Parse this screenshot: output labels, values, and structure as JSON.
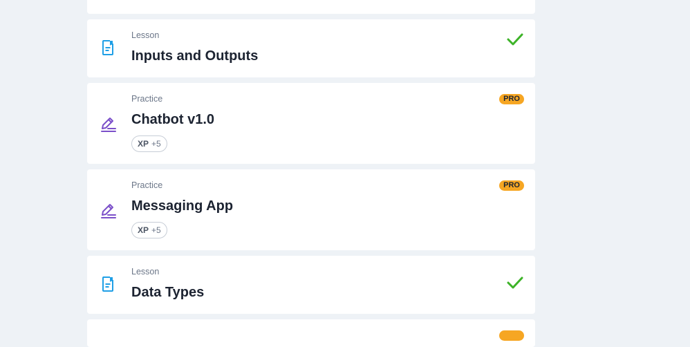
{
  "items": [
    {
      "kind": "lesson",
      "type": "Lesson",
      "title": "Inputs and Outputs",
      "completed": true
    },
    {
      "kind": "practice",
      "type": "Practice",
      "title": "Chatbot v1.0",
      "badge": "PRO",
      "xp_label": "XP",
      "xp_value": "+5"
    },
    {
      "kind": "practice",
      "type": "Practice",
      "title": "Messaging App",
      "badge": "PRO",
      "xp_label": "XP",
      "xp_value": "+5"
    },
    {
      "kind": "lesson",
      "type": "Lesson",
      "title": "Data Types",
      "completed": true
    }
  ],
  "icons": {
    "lesson": "lesson-document-icon",
    "practice": "practice-pencil-icon",
    "completed": "checkmark-icon"
  },
  "colors": {
    "lesson_icon": "#1f9fe6",
    "practice_icon": "#7b4fc9",
    "check": "#3db328",
    "pro_badge": "#f6a623",
    "background": "#eef2f6",
    "card": "#ffffff"
  }
}
